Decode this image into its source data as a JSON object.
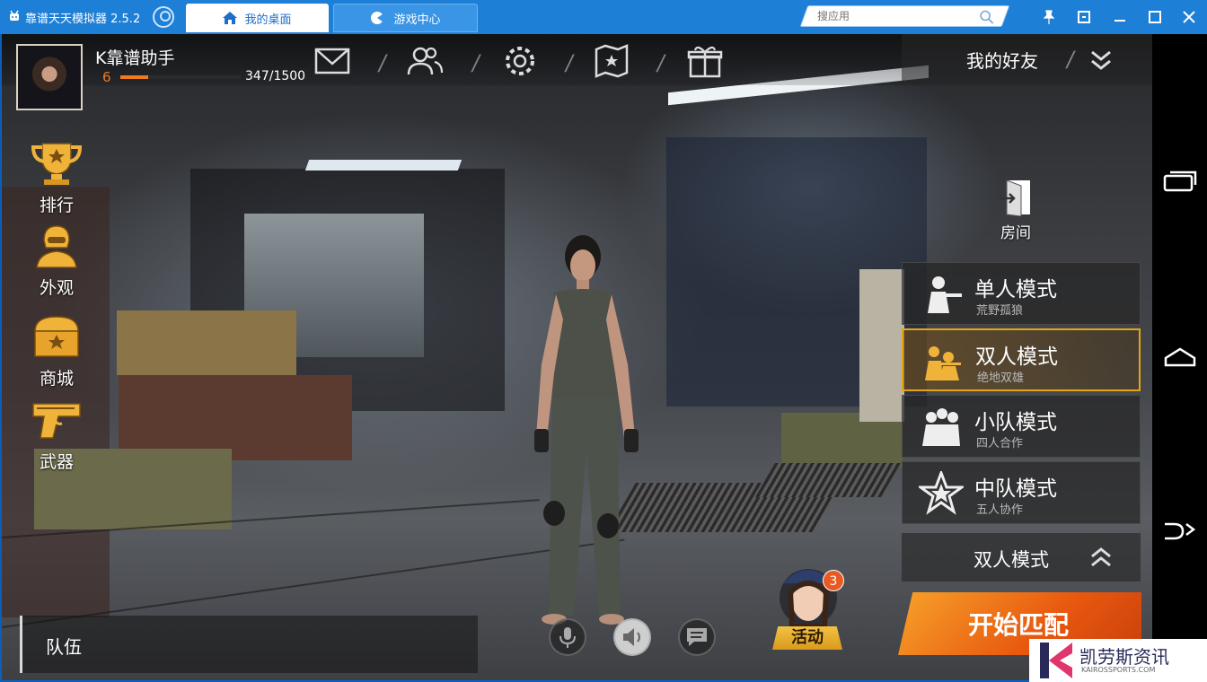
{
  "window": {
    "title": "靠谱天天模拟器 2.5.2",
    "tabs": [
      {
        "label": "我的桌面"
      },
      {
        "label": "游戏中心"
      }
    ],
    "search_placeholder": "搜应用"
  },
  "player": {
    "name": "K靠谱助手",
    "level": "6",
    "xp_text": "347/1500",
    "xp_fraction": 0.231
  },
  "topnav": {
    "friends_label": "我的好友"
  },
  "left_menu": [
    {
      "label": "排行",
      "icon": "trophy-icon"
    },
    {
      "label": "外观",
      "icon": "soldier-icon"
    },
    {
      "label": "商城",
      "icon": "chest-icon"
    },
    {
      "label": "武器",
      "icon": "pistol-icon"
    }
  ],
  "room": {
    "label": "房间"
  },
  "modes": [
    {
      "title": "单人模式",
      "subtitle": "荒野孤狼"
    },
    {
      "title": "双人模式",
      "subtitle": "绝地双雄"
    },
    {
      "title": "小队模式",
      "subtitle": "四人合作"
    },
    {
      "title": "中队模式",
      "subtitle": "五人协作"
    }
  ],
  "selected_mode": {
    "label": "双人模式"
  },
  "start_button": {
    "label": "开始匹配"
  },
  "team": {
    "label": "队伍"
  },
  "event": {
    "label": "活动",
    "badge": "3"
  },
  "watermark": {
    "text": "凯劳斯资讯",
    "sub": "KAIROSSPORTS.COM"
  },
  "colors": {
    "accent": "#f07b1c",
    "titlebar": "#1e7fd6",
    "selected_border": "#e6a417"
  }
}
